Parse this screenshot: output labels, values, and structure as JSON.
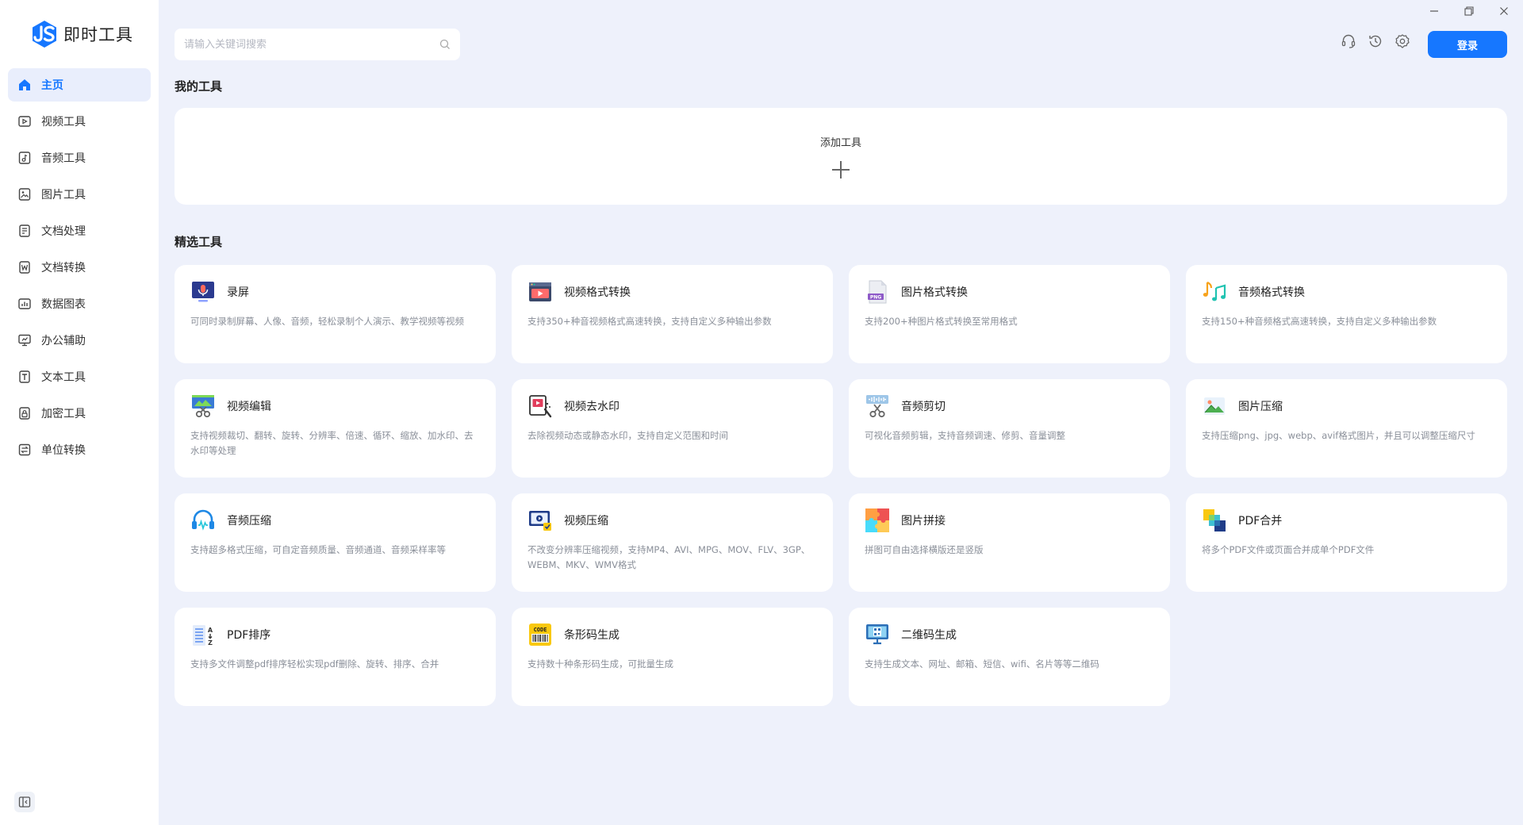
{
  "app": {
    "name": "即时工具"
  },
  "sidebar": {
    "items": [
      {
        "label": "主页",
        "icon": "home-icon",
        "active": true
      },
      {
        "label": "视频工具",
        "icon": "video-icon"
      },
      {
        "label": "音频工具",
        "icon": "audio-icon"
      },
      {
        "label": "图片工具",
        "icon": "image-icon"
      },
      {
        "label": "文档处理",
        "icon": "document-icon"
      },
      {
        "label": "文档转换",
        "icon": "word-icon"
      },
      {
        "label": "数据图表",
        "icon": "chart-icon"
      },
      {
        "label": "办公辅助",
        "icon": "monitor-icon"
      },
      {
        "label": "文本工具",
        "icon": "text-icon"
      },
      {
        "label": "加密工具",
        "icon": "lock-icon"
      },
      {
        "label": "单位转换",
        "icon": "convert-icon"
      }
    ]
  },
  "search": {
    "placeholder": "请输入关键词搜索",
    "value": ""
  },
  "header": {
    "login_label": "登录"
  },
  "my_tools": {
    "title": "我的工具",
    "add_label": "添加工具"
  },
  "featured": {
    "title": "精选工具",
    "tools": [
      {
        "name": "录屏",
        "desc": "可同时录制屏幕、人像、音频，轻松录制个人演示、教学视频等视频",
        "icon": "screen-record-icon"
      },
      {
        "name": "视频格式转换",
        "desc": "支持350+种音视频格式高速转换，支持自定义多种输出参数",
        "icon": "video-convert-icon"
      },
      {
        "name": "图片格式转换",
        "desc": "支持200+种图片格式转换至常用格式",
        "icon": "png-file-icon"
      },
      {
        "name": "音频格式转换",
        "desc": "支持150+种音频格式高速转换，支持自定义多种输出参数",
        "icon": "music-notes-icon"
      },
      {
        "name": "视频编辑",
        "desc": "支持视频裁切、翻转、旋转、分辨率、倍速、循环、缩放、加水印、去水印等处理",
        "icon": "video-edit-icon"
      },
      {
        "name": "视频去水印",
        "desc": "去除视频动态或静态水印，支持自定义范围和时间",
        "icon": "watermark-remove-icon"
      },
      {
        "name": "音频剪切",
        "desc": "可视化音频剪辑，支持音频调速、修剪、音量调整",
        "icon": "audio-cut-icon"
      },
      {
        "name": "图片压缩",
        "desc": "支持压缩png、jpg、webp、avif格式图片，并且可以调整压缩尺寸",
        "icon": "image-compress-icon"
      },
      {
        "name": "音频压缩",
        "desc": "支持超多格式压缩，可自定音频质量、音频通道、音频采样率等",
        "icon": "headphones-icon"
      },
      {
        "name": "视频压缩",
        "desc": "不改变分辨率压缩视频，支持MP4、AVI、MPG、MOV、FLV、3GP、WEBM、MKV、WMV格式",
        "icon": "video-compress-icon"
      },
      {
        "name": "图片拼接",
        "desc": "拼图可自由选择横版还是竖版",
        "icon": "puzzle-icon"
      },
      {
        "name": "PDF合并",
        "desc": "将多个PDF文件或页面合并成单个PDF文件",
        "icon": "pdf-merge-icon"
      },
      {
        "name": "PDF排序",
        "desc": "支持多文件调整pdf排序轻松实现pdf删除、旋转、排序、合并",
        "icon": "pdf-sort-icon"
      },
      {
        "name": "条形码生成",
        "desc": "支持数十种条形码生成，可批量生成",
        "icon": "barcode-icon"
      },
      {
        "name": "二维码生成",
        "desc": "支持生成文本、网址、邮箱、短信、wifi、名片等等二维码",
        "icon": "qrcode-icon"
      }
    ]
  }
}
